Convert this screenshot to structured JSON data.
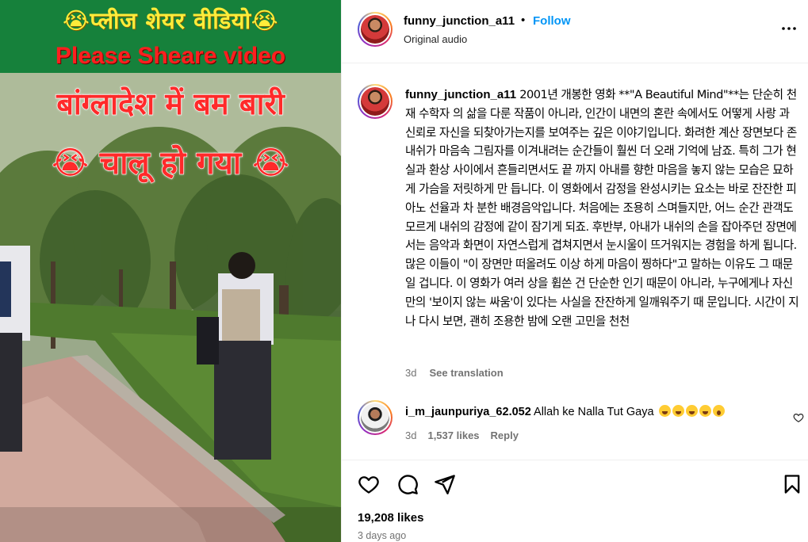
{
  "video": {
    "banner_line1": "😭प्लीज शेयर वीडियो😭",
    "banner_line2": "Please Sheare video",
    "overlay_line1": "बांग्लादेश में बम बारी",
    "overlay_line2": "😭 चालू हो गया 😭"
  },
  "header": {
    "username": "funny_junction_a11",
    "separator": "•",
    "follow_label": "Follow",
    "audio": "Original audio",
    "more_icon": "more-options-icon"
  },
  "caption": {
    "username": "funny_junction_a11",
    "text": "2001년 개봉한 영화 **\"A Beautiful Mind\"**는 단순히 천재 수학자 의 삶을 다룬 작품이 아니라, 인간이 내면의 혼란 속에서도 어떻게 사랑 과 신뢰로 자신을 되찾아가는지를 보여주는 깊은 이야기입니다. 화려한 계산 장면보다 존 내쉬가 마음속 그림자를 이겨내려는 순간들이 훨씬 더 오래 기억에 남죠. 특히 그가 현실과 환상 사이에서 흔들리면서도 끝 까지 아내를 향한 마음을 놓지 않는 모습은 묘하게 가슴을 저릿하게 만 듭니다. 이 영화에서 감정을 완성시키는 요소는 바로 잔잔한 피아노 선율과 차 분한 배경음악입니다. 처음에는 조용히 스며들지만, 어느 순간 관객도 모르게 내쉬의 감정에 같이 잠기게 되죠. 후반부, 아내가 내쉬의 손을 잡아주던 장면에서는 음악과 화면이 자연스럽게 겹쳐지면서 눈시울이 뜨거워지는 경험을 하게 됩니다. 많은 이들이 \"이 장면만 떠올려도 이상 하게 마음이 찡하다\"고 말하는 이유도 그 때문일 겁니다. 이 영화가 여러 상을 휩쓴 건 단순한 인기 때문이 아니라, 누구에게나 자신만의 '보이지 않는 싸움'이 있다는 사실을 잔잔하게 일깨워주기 때 문입니다. 시간이 지나 다시 보면, 괜히 조용한 밤에 오랜 고민을 천천",
    "age": "3d",
    "see_translation": "See translation"
  },
  "comment": {
    "username": "i_m_jaunpuriya_62.052",
    "text": "Allah ke Nalla Tut Gaya",
    "age": "3d",
    "likes": "1,537 likes",
    "reply": "Reply"
  },
  "actions": {
    "icons": [
      "heart-icon",
      "comment-icon",
      "share-icon",
      "bookmark-icon"
    ],
    "likes": "19,208 likes",
    "posted": "3 days ago"
  },
  "colors": {
    "accent": "#0095f6",
    "muted": "#737373",
    "banner_green": "#16813b",
    "banner_yellow": "#ffec3a",
    "overlay_red": "#ff2a2a"
  }
}
